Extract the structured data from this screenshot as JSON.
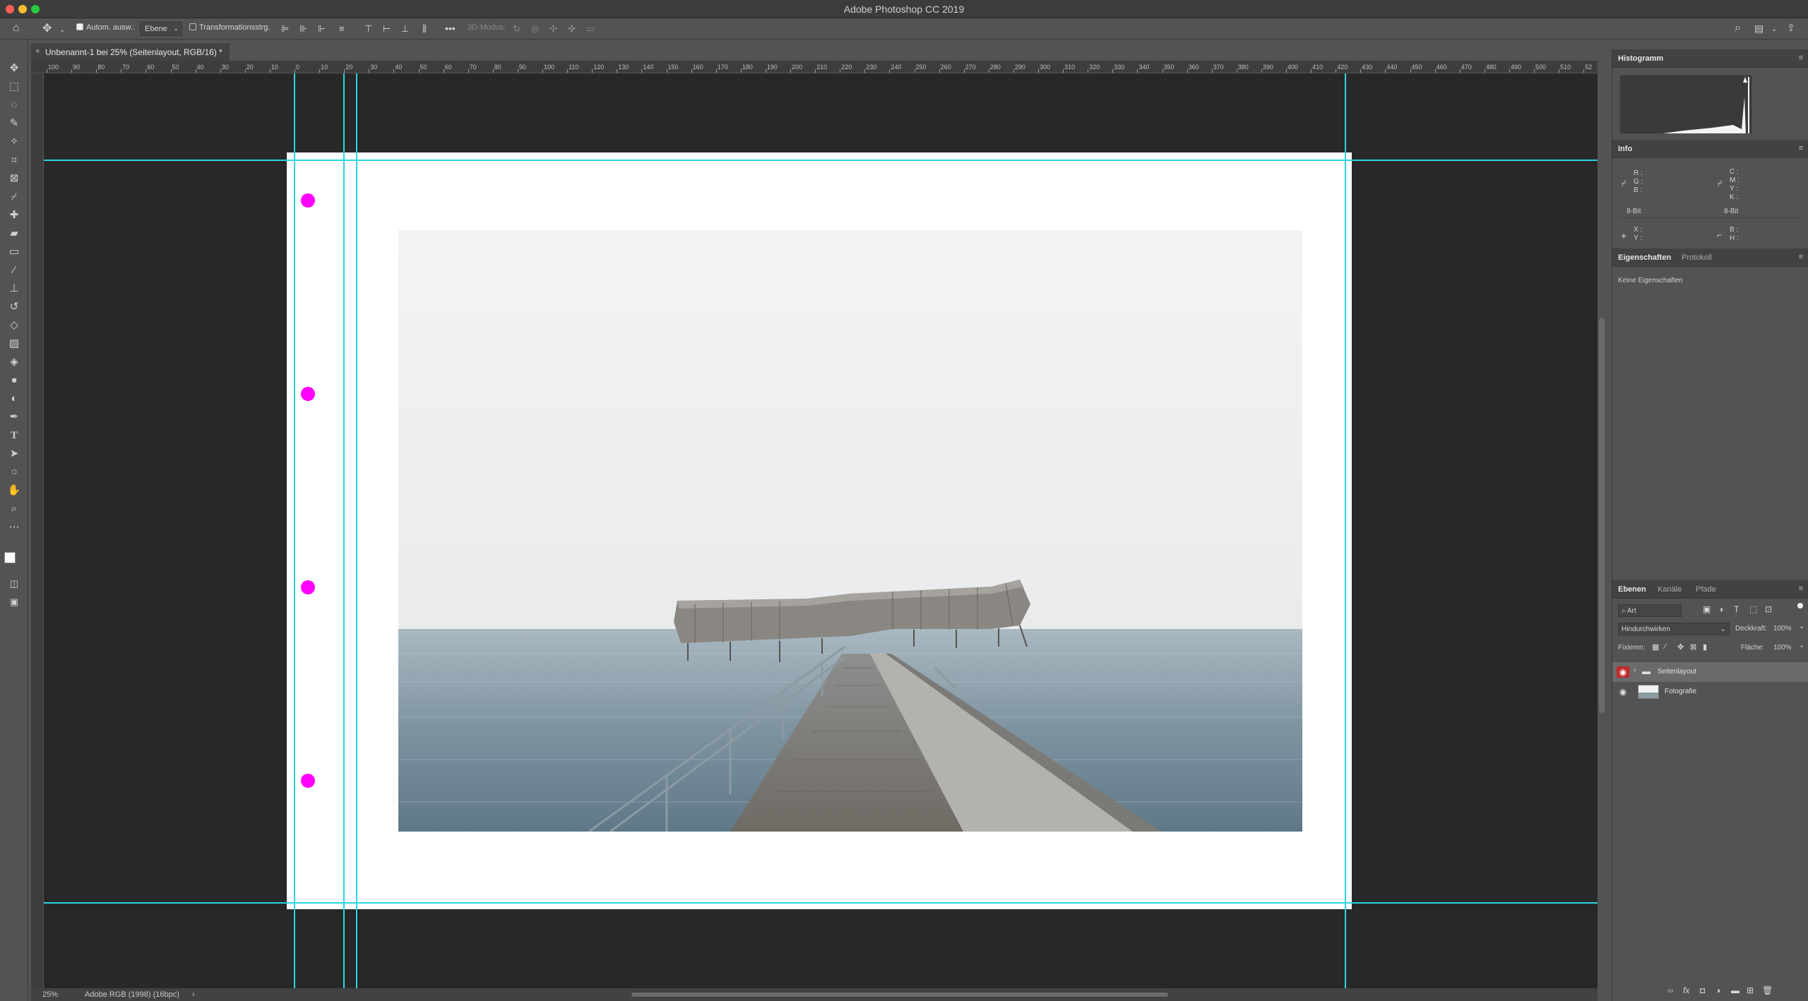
{
  "app": {
    "title": "Adobe Photoshop CC 2019"
  },
  "options_bar": {
    "auto_select_label": "Autom. ausw.:",
    "auto_select_target": "Ebene",
    "transform_controls_label": "Transformationsstrg.",
    "mode_3d_label": "3D-Modus:",
    "more_label": "•••"
  },
  "document": {
    "tab_title": "Unbenannt-1 bei 25% (Seitenlayout, RGB/16) *",
    "close_label": "×"
  },
  "ruler": {
    "labels": [
      "100",
      "90",
      "80",
      "70",
      "60",
      "50",
      "40",
      "30",
      "20",
      "10",
      "0",
      "10",
      "20",
      "30",
      "40",
      "50",
      "60",
      "70",
      "80",
      "90",
      "100",
      "110",
      "120",
      "130",
      "140",
      "150",
      "160",
      "170",
      "180",
      "190",
      "200",
      "210",
      "220",
      "230",
      "240",
      "250",
      "260",
      "270",
      "280",
      "290",
      "300",
      "310",
      "320",
      "330",
      "340",
      "350",
      "360",
      "370",
      "380",
      "390",
      "400",
      "410",
      "420",
      "430",
      "440",
      "450",
      "460",
      "470",
      "480",
      "490",
      "500",
      "510",
      "52"
    ]
  },
  "status_bar": {
    "zoom": "25%",
    "profile": "Adobe RGB (1998) (16bpc)",
    "arrow": "›"
  },
  "panels": {
    "histogram": {
      "tab": "Histogramm"
    },
    "info": {
      "tab": "Info",
      "rgb_labels": [
        "R :",
        "G :",
        "B :"
      ],
      "cmyk_labels": [
        "C :",
        "M :",
        "Y :",
        "K :"
      ],
      "bit_left": "8-Bit",
      "bit_right": "8-Bit",
      "xy_labels": [
        "X :",
        "Y :"
      ],
      "wh_labels": [
        "B :",
        "H :"
      ]
    },
    "properties": {
      "tabs": [
        "Eigenschaften",
        "Protokoll"
      ],
      "empty_text": "Keine Eigenschaften"
    },
    "layers": {
      "tabs": [
        "Ebenen",
        "Kanäle",
        "Pfade"
      ],
      "filter_label": "Art",
      "blend_mode": "Hindurchwirken",
      "opacity_label": "Deckkraft:",
      "opacity_value": "100%",
      "lock_label": "Fixieren:",
      "fill_label": "Fläche:",
      "fill_value": "100%",
      "items": [
        {
          "name": "Seitenlayout",
          "type": "group"
        },
        {
          "name": "Fotografie",
          "type": "image"
        }
      ]
    }
  },
  "colors": {
    "guide": "#2bd4de",
    "marker": "#ff00ff",
    "canvas_bg": "#282828"
  }
}
